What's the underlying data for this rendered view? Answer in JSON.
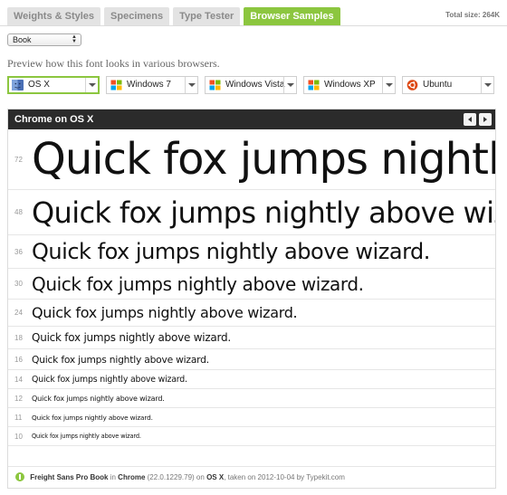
{
  "tabs": [
    {
      "label": "Weights & Styles",
      "active": false
    },
    {
      "label": "Specimens",
      "active": false
    },
    {
      "label": "Type Tester",
      "active": false
    },
    {
      "label": "Browser Samples",
      "active": true
    }
  ],
  "total_size": {
    "label": "Total size:",
    "value": "264K"
  },
  "weight_select": {
    "value": "Book"
  },
  "intro_text": "Preview how this font looks in various browsers.",
  "browsers": [
    {
      "label": "OS X",
      "icon": "mac-os-icon",
      "selected": true
    },
    {
      "label": "Windows 7",
      "icon": "windows-icon",
      "selected": false
    },
    {
      "label": "Windows Vista",
      "icon": "windows-icon",
      "selected": false
    },
    {
      "label": "Windows XP",
      "icon": "windows-icon",
      "selected": false
    },
    {
      "label": "Ubuntu",
      "icon": "ubuntu-icon",
      "selected": false
    }
  ],
  "panel": {
    "title": "Chrome on OS X"
  },
  "sample_text": "Quick fox jumps nightly above wizard.",
  "samples": [
    {
      "size": "72",
      "font_px": 48
    },
    {
      "size": "48",
      "font_px": 32
    },
    {
      "size": "36",
      "font_px": 24
    },
    {
      "size": "30",
      "font_px": 20
    },
    {
      "size": "24",
      "font_px": 16
    },
    {
      "size": "18",
      "font_px": 12
    },
    {
      "size": "16",
      "font_px": 10.7
    },
    {
      "size": "14",
      "font_px": 9.4
    },
    {
      "size": "12",
      "font_px": 8
    },
    {
      "size": "11",
      "font_px": 7.3
    },
    {
      "size": "10",
      "font_px": 6.6
    }
  ],
  "footer": {
    "font": "Freight Sans Pro Book",
    "in": "in",
    "browser": "Chrome",
    "version": "(22.0.1229.79)",
    "on": "on",
    "os": "OS X",
    "taken": ", taken on 2012-10-04 by Typekit.com"
  },
  "colors": {
    "accent": "#8cc63f",
    "header": "#2b2b2b"
  }
}
